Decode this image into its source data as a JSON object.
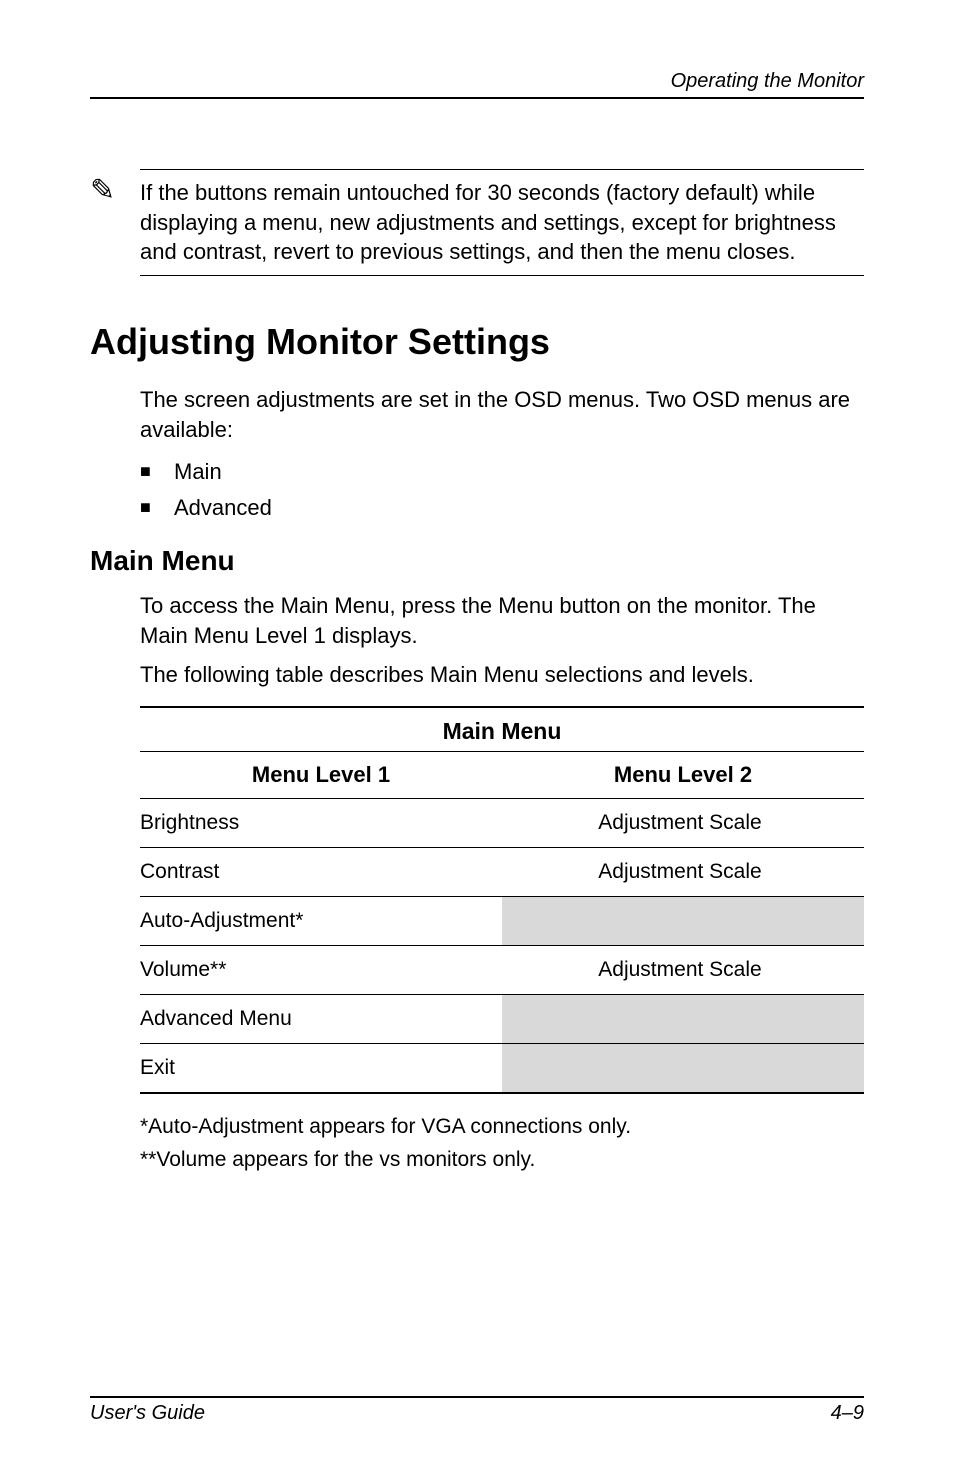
{
  "header": {
    "running_title": "Operating the Monitor"
  },
  "note": {
    "icon": "✎",
    "text": "If the buttons remain untouched for 30 seconds (factory default) while displaying a menu, new adjustments and settings, except for brightness and contrast, revert to previous settings, and then the menu closes."
  },
  "section": {
    "title": "Adjusting Monitor Settings",
    "intro": "The screen adjustments are set in the OSD menus. Two OSD menus are available:",
    "bullets": [
      "Main",
      "Advanced"
    ]
  },
  "subsection": {
    "title": "Main Menu",
    "p1": "To access the Main Menu, press the Menu button on the monitor. The Main Menu Level 1 displays.",
    "p2": "The following table describes Main Menu selections and levels."
  },
  "table": {
    "title": "Main Menu",
    "headers": {
      "col1": "Menu Level 1",
      "col2": "Menu Level 2"
    },
    "rows": [
      {
        "c1": "Brightness",
        "c2": "Adjustment Scale",
        "shaded": false
      },
      {
        "c1": "Contrast",
        "c2": "Adjustment Scale",
        "shaded": false
      },
      {
        "c1": "Auto-Adjustment*",
        "c2": "",
        "shaded": true
      },
      {
        "c1": "Volume**",
        "c2": "Adjustment Scale",
        "shaded": false
      },
      {
        "c1": "Advanced Menu",
        "c2": "",
        "shaded": true
      },
      {
        "c1": "Exit",
        "c2": "",
        "shaded": true
      }
    ],
    "notes": [
      "*Auto-Adjustment appears for VGA connections only.",
      "**Volume appears for the vs monitors only."
    ]
  },
  "footer": {
    "left": "User's Guide",
    "right": "4–9"
  }
}
